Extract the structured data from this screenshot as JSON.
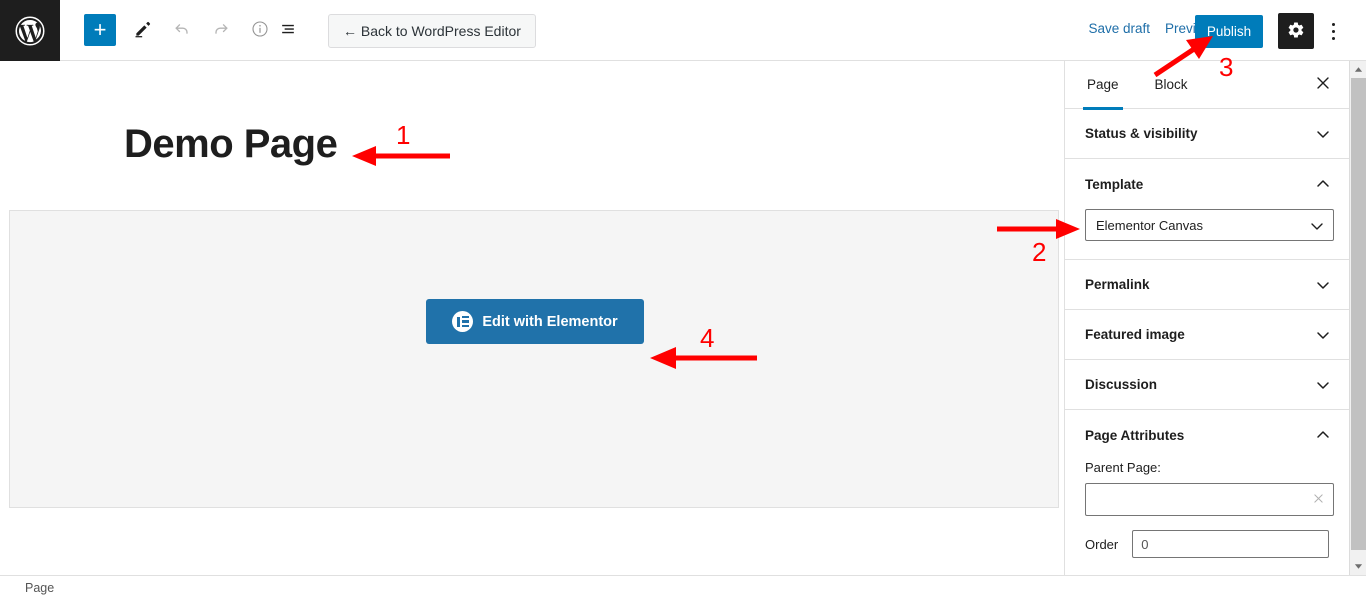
{
  "app": {
    "name": "WordPress Block Editor",
    "logo_icon": "wordpress-logo-icon"
  },
  "toolbar": {
    "add_block_label": "+",
    "add_block_icon": "plus-icon",
    "tools_icon": "pencil-icon",
    "undo_icon": "undo-arrow-icon",
    "redo_icon": "redo-arrow-icon",
    "details_icon": "info-circle-icon",
    "list_view_icon": "list-view-icon",
    "back_button_label": "← Back to WordPress Editor",
    "save_draft_label": "Save draft",
    "preview_label": "Preview",
    "publish_label": "Publish",
    "settings_icon": "gear-icon",
    "options_icon": "vertical-ellipsis-icon"
  },
  "editor": {
    "page_title": "Demo Page",
    "elementor_button_label": "Edit with Elementor",
    "elementor_button_icon": "elementor-logo-icon",
    "elementor_button_color": "#2072aa",
    "canvas_background": "#f5f5f5"
  },
  "sidebar": {
    "tabs": [
      {
        "label": "Page",
        "active": true
      },
      {
        "label": "Block",
        "active": false
      }
    ],
    "close_icon": "close-x-icon",
    "active_tab_color": "#007cba",
    "panels": [
      {
        "title": "Status & visibility",
        "expanded": false,
        "chevron": "chevron-down-icon"
      },
      {
        "title": "Template",
        "expanded": true,
        "chevron": "chevron-up-icon"
      },
      {
        "title": "Permalink",
        "expanded": false,
        "chevron": "chevron-down-icon"
      },
      {
        "title": "Featured image",
        "expanded": false,
        "chevron": "chevron-down-icon"
      },
      {
        "title": "Discussion",
        "expanded": false,
        "chevron": "chevron-down-icon"
      },
      {
        "title": "Page Attributes",
        "expanded": true,
        "chevron": "chevron-up-icon"
      }
    ],
    "template": {
      "selected": "Elementor Canvas",
      "chevron": "chevron-down-icon"
    },
    "page_attributes": {
      "parent_label": "Parent Page:",
      "parent_value": "",
      "parent_placeholder": "",
      "parent_clear_icon": "clear-x-icon",
      "order_label": "Order",
      "order_value": "0"
    }
  },
  "scrollbar": {
    "up_icon": "scroll-up-arrow-icon",
    "down_icon": "scroll-down-arrow-icon"
  },
  "statusbar": {
    "label": "Page"
  },
  "annotations": {
    "color": "#ff0000",
    "markers": [
      {
        "number": "1",
        "target": "page-title"
      },
      {
        "number": "2",
        "target": "template-select"
      },
      {
        "number": "3",
        "target": "publish-button"
      },
      {
        "number": "4",
        "target": "edit-with-elementor-button"
      }
    ]
  }
}
